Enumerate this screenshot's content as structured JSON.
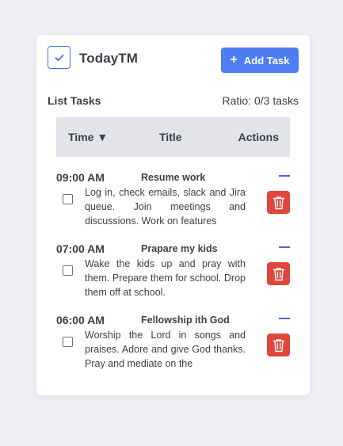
{
  "app": {
    "title": "TodayTM",
    "logo_icon": "check-icon"
  },
  "toolbar": {
    "add_label": "Add Task",
    "add_icon": "plus-icon"
  },
  "list": {
    "title": "List Tasks",
    "ratio": "Ratio: 0/3 tasks"
  },
  "table": {
    "headers": {
      "time": "Time ▼",
      "title": "Title",
      "actions": "Actions"
    }
  },
  "tasks": [
    {
      "time": "09:00 AM",
      "title": "Resume work",
      "description": "Log in, check emails, slack and Jira queue. Join meetings and discussions. Work on features",
      "checked": false
    },
    {
      "time": "07:00 AM",
      "title": "Prapare my kids",
      "description": "Wake the kids up and pray with them. Prepare them for school. Drop them off at school.",
      "checked": false
    },
    {
      "time": "06:00 AM",
      "title": "Fellowship ith God",
      "description": "Worship the Lord in songs and praises. Adore and give God thanks. Pray and mediate on the",
      "checked": false
    }
  ],
  "colors": {
    "accent": "#4f7df3",
    "danger": "#e0463b",
    "dash": "#4f63e0",
    "background": "#eef0f5"
  }
}
